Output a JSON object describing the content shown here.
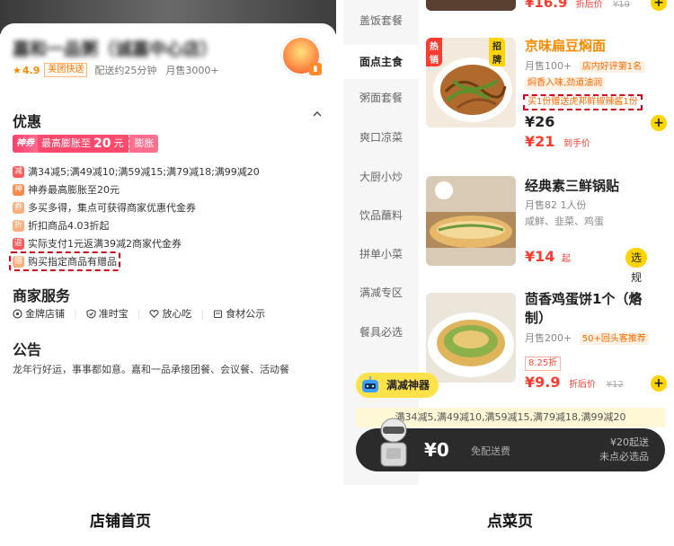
{
  "left": {
    "store_name": "嘉和一品粥（诚嘉中心店）",
    "rating": "4.9",
    "delivery_tag": "美团快送",
    "delivery_time": "配送约25分钟",
    "monthly_sales": "月售3000+",
    "promo_title": "优惠",
    "banner": {
      "tag": "神券",
      "text": "最高膨胀至",
      "amount": "20",
      "unit": "元",
      "action": "膨胀"
    },
    "promos": [
      {
        "tag": "减",
        "text": "满34减5;满49减10;满59减15;满79减18;满99减20"
      },
      {
        "tag": "神",
        "text": "神券最高膨胀至20元"
      },
      {
        "tag": "券",
        "text": "多买多得，集点可获得商家优惠代金券"
      },
      {
        "tag": "折",
        "text": "折扣商品4.03折起"
      },
      {
        "tag": "返",
        "text": "实际支付1元返满39减2商家代金券"
      },
      {
        "tag": "赠",
        "text": "购买指定商品有赠品"
      }
    ],
    "service_title": "商家服务",
    "services": [
      "金牌店铺",
      "准时宝",
      "放心吃",
      "食材公示"
    ],
    "notice_title": "公告",
    "notice_text": "龙年行好运，事事都如意。嘉和一品承接团餐、会议餐、活动餐"
  },
  "right": {
    "categories": [
      "盖饭套餐",
      "面点主食",
      "粥面套餐",
      "爽口凉菜",
      "大厨小炒",
      "饮品蘸料",
      "拼单小菜",
      "满减专区",
      "餐具必选"
    ],
    "active_category": 1,
    "top_price": {
      "price": "¥16.9",
      "label": "折后价",
      "original": "¥19"
    },
    "dishes": [
      {
        "name": "京味扁豆焖面",
        "badge_left": "热销",
        "badge_right": "招牌",
        "sales": "月售100+",
        "rank_tag": "店内好评第1名",
        "flavor_tag": "焖香入味,劲道油润",
        "gift_text": "买1份赠送虎邦鲜椒辣酱1份",
        "price": "¥26",
        "final_price": "¥21",
        "final_label": "到手价"
      },
      {
        "name": "经典素三鲜锅贴",
        "sales": "月售82  1人份",
        "desc": "咸鲜、韭菜、鸡蛋",
        "price": "¥14",
        "price_suffix": "起",
        "spec_button": "选规格"
      },
      {
        "name_line1": "茴香鸡蛋饼1个（烙",
        "name_line2": "制）",
        "sales": "月售200+",
        "repeat_tag": "50+回头客推荐",
        "discount": "8.25折",
        "price": "¥9.9",
        "price_label": "折后价",
        "original": "¥12"
      }
    ],
    "mj_tool": "满减神器",
    "mj_bar": "满34减5,满49减10,满59减15,满79减18,满99减20",
    "cart": {
      "price": "¥0",
      "free_delivery": "免配送费",
      "min_order": "¥20起送",
      "status": "未点必选品"
    }
  },
  "captions": {
    "left": "店铺首页",
    "right": "点菜页"
  },
  "colors": {
    "accent": "#ff3b30",
    "brand_yellow": "#ffd400",
    "dashed_box": "#d0021b"
  }
}
